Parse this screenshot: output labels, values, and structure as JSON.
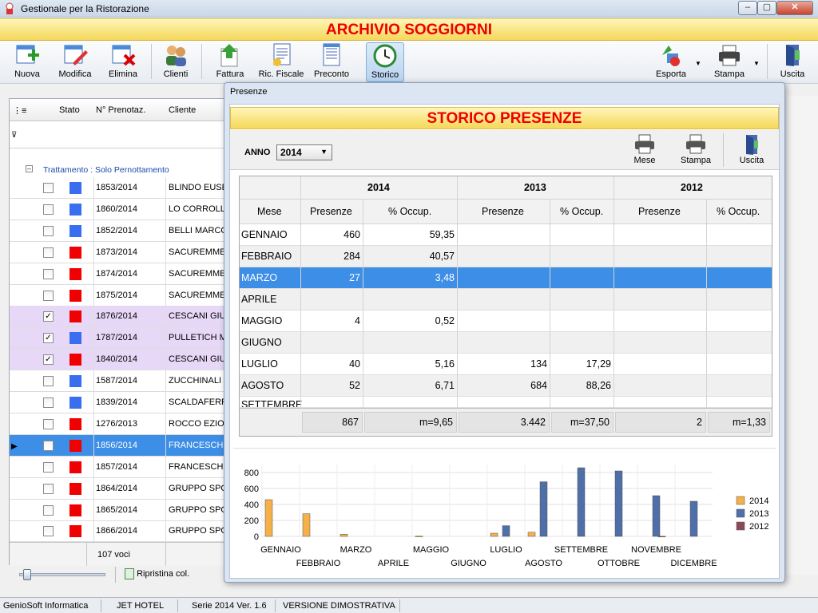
{
  "window": {
    "title": "Gestionale per la Ristorazione",
    "min": "–",
    "max": "▢",
    "close": "✕"
  },
  "banner": {
    "title": "ARCHIVIO SOGGIORNI"
  },
  "toolbar": {
    "nuova": "Nuova",
    "modifica": "Modifica",
    "elimina": "Elimina",
    "clienti": "Clienti",
    "fattura": "Fattura",
    "ric_fiscale": "Ric. Fiscale",
    "preconto": "Preconto",
    "storico": "Storico",
    "esporta": "Esporta",
    "stampa": "Stampa",
    "uscita": "Uscita"
  },
  "grid": {
    "headers": {
      "stato": "Stato",
      "prenotaz": "N° Prenotaz.",
      "cliente": "Cliente"
    },
    "group": "Trattamento : Solo Pernottamento",
    "rows": [
      {
        "checked": "",
        "color": "#3a6ef0",
        "num": "1853/2014",
        "cliente": "BLINDO EUSE"
      },
      {
        "checked": "",
        "color": "#3a6ef0",
        "num": "1860/2014",
        "cliente": "LO CORROLLI"
      },
      {
        "checked": "",
        "color": "#3a6ef0",
        "num": "1852/2014",
        "cliente": "BELLI MARCO"
      },
      {
        "checked": "",
        "color": "#f00000",
        "num": "1873/2014",
        "cliente": "SACUREMME"
      },
      {
        "checked": "",
        "color": "#f00000",
        "num": "1874/2014",
        "cliente": "SACUREMME"
      },
      {
        "checked": "",
        "color": "#f00000",
        "num": "1875/2014",
        "cliente": "SACUREMME"
      },
      {
        "checked": "✓",
        "color": "#f00000",
        "num": "1876/2014",
        "cliente": "CESCANI GIU"
      },
      {
        "checked": "✓",
        "color": "#3a6ef0",
        "num": "1787/2014",
        "cliente": "PULLETICH M"
      },
      {
        "checked": "✓",
        "color": "#f00000",
        "num": "1840/2014",
        "cliente": "CESCANI GIU"
      },
      {
        "checked": "",
        "color": "#3a6ef0",
        "num": "1587/2014",
        "cliente": "ZUCCHINALI"
      },
      {
        "checked": "",
        "color": "#3a6ef0",
        "num": "1839/2014",
        "cliente": "SCALDAFERR"
      },
      {
        "checked": "",
        "color": "#f00000",
        "num": "1276/2013",
        "cliente": "ROCCO EZIO"
      },
      {
        "checked": "",
        "color": "#f00000",
        "num": "1856/2014",
        "cliente": "FRANCESCHI"
      },
      {
        "checked": "",
        "color": "#f00000",
        "num": "1857/2014",
        "cliente": "FRANCESCHI"
      },
      {
        "checked": "",
        "color": "#f00000",
        "num": "1864/2014",
        "cliente": "GRUPPO SPO"
      },
      {
        "checked": "",
        "color": "#f00000",
        "num": "1865/2014",
        "cliente": "GRUPPO SPO"
      },
      {
        "checked": "",
        "color": "#f00000",
        "num": "1866/2014",
        "cliente": "GRUPPO SPO"
      }
    ],
    "count": "107 voci",
    "ripristina": "Ripristina col."
  },
  "status": {
    "company": "GenioSoft Informatica",
    "product": "JET HOTEL",
    "version": "Serie 2014 Ver. 1.6",
    "mode": "VERSIONE DIMOSTRATIVA"
  },
  "dialog": {
    "title": "Presenze",
    "banner": "STORICO PRESENZE",
    "anno_label": "ANNO",
    "anno_value": "2014",
    "mese": "Mese",
    "stampa": "Stampa",
    "uscita": "Uscita",
    "years": [
      "2014",
      "2013",
      "2012"
    ],
    "col_mese": "Mese",
    "col_presenze": "Presenze",
    "col_occup": "% Occup.",
    "rows": [
      {
        "mese": "GENNAIO",
        "p14": "460",
        "o14": "59,35",
        "p13": "",
        "o13": "",
        "p12": "",
        "o12": ""
      },
      {
        "mese": "FEBBRAIO",
        "p14": "284",
        "o14": "40,57",
        "p13": "",
        "o13": "",
        "p12": "",
        "o12": ""
      },
      {
        "mese": "MARZO",
        "p14": "27",
        "o14": "3,48",
        "p13": "",
        "o13": "",
        "p12": "",
        "o12": ""
      },
      {
        "mese": "APRILE",
        "p14": "",
        "o14": "",
        "p13": "",
        "o13": "",
        "p12": "",
        "o12": ""
      },
      {
        "mese": "MAGGIO",
        "p14": "4",
        "o14": "0,52",
        "p13": "",
        "o13": "",
        "p12": "",
        "o12": ""
      },
      {
        "mese": "GIUGNO",
        "p14": "",
        "o14": "",
        "p13": "",
        "o13": "",
        "p12": "",
        "o12": ""
      },
      {
        "mese": "LUGLIO",
        "p14": "40",
        "o14": "5,16",
        "p13": "134",
        "o13": "17,29",
        "p12": "",
        "o12": ""
      },
      {
        "mese": "AGOSTO",
        "p14": "52",
        "o14": "6,71",
        "p13": "684",
        "o13": "88,26",
        "p12": "",
        "o12": ""
      }
    ],
    "totals": {
      "p14": "867",
      "o14": "m=9,65",
      "p13": "3.442",
      "o13": "m=37,50",
      "p12": "2",
      "o12": "m=1,33"
    }
  },
  "chart_data": {
    "type": "bar",
    "categories": [
      "GENNAIO",
      "FEBBRAIO",
      "MARZO",
      "APRILE",
      "MAGGIO",
      "GIUGNO",
      "LUGLIO",
      "AGOSTO",
      "SETTEMBRE",
      "OTTOBRE",
      "NOVEMBRE",
      "DICEMBRE"
    ],
    "series": [
      {
        "name": "2014",
        "color": "#f5b04a",
        "values": [
          460,
          284,
          27,
          0,
          4,
          0,
          40,
          52,
          0,
          0,
          0,
          0
        ]
      },
      {
        "name": "2013",
        "color": "#4f6fa8",
        "values": [
          0,
          0,
          0,
          0,
          0,
          0,
          134,
          684,
          860,
          820,
          510,
          440
        ]
      },
      {
        "name": "2012",
        "color": "#8b4a5a",
        "values": [
          0,
          0,
          0,
          0,
          0,
          0,
          0,
          0,
          0,
          0,
          2,
          0
        ]
      }
    ],
    "yticks": [
      "0",
      "200",
      "400",
      "600",
      "800"
    ],
    "ylim": [
      0,
      900
    ],
    "legend": "right"
  }
}
